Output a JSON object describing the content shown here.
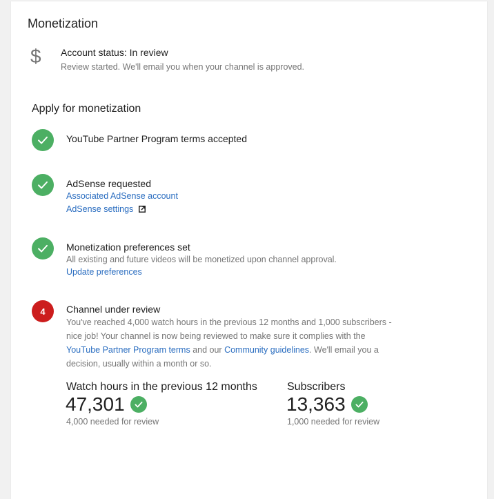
{
  "card": {
    "title": "Monetization"
  },
  "account_status": {
    "icon": "dollar-icon",
    "title": "Account status: In review",
    "subtitle": "Review started. We'll email you when your channel is approved."
  },
  "apply": {
    "title": "Apply for monetization",
    "steps": [
      {
        "status": "done",
        "title": "YouTube Partner Program terms accepted"
      },
      {
        "status": "done",
        "title": "AdSense requested",
        "link1": "Associated AdSense account",
        "link2": "AdSense settings"
      },
      {
        "status": "done",
        "title": "Monetization preferences set",
        "subtitle": "All existing and future videos will be monetized upon channel approval.",
        "link": "Update preferences"
      },
      {
        "status": "active",
        "number": "4",
        "title": "Channel under review",
        "text_part1": "You've reached 4,000 watch hours in the previous 12 months and 1,000 subscribers - nice job! Your channel is now being reviewed to make sure it complies with the ",
        "link_terms": "YouTube Partner Program terms",
        "text_part2": " and our ",
        "link_guidelines": "Community guidelines",
        "text_part3": ". We'll email you a decision, usually within a month or so."
      }
    ]
  },
  "metrics": {
    "watch_hours": {
      "label": "Watch hours in the previous 12 months",
      "value": "47,301",
      "sub": "4,000 needed for review"
    },
    "subscribers": {
      "label": "Subscribers",
      "value": "13,363",
      "sub": "1,000 needed for review"
    }
  },
  "colors": {
    "check_green": "#4caf63",
    "step_red": "#cc1d1d",
    "link_blue": "#2a6dc0"
  }
}
